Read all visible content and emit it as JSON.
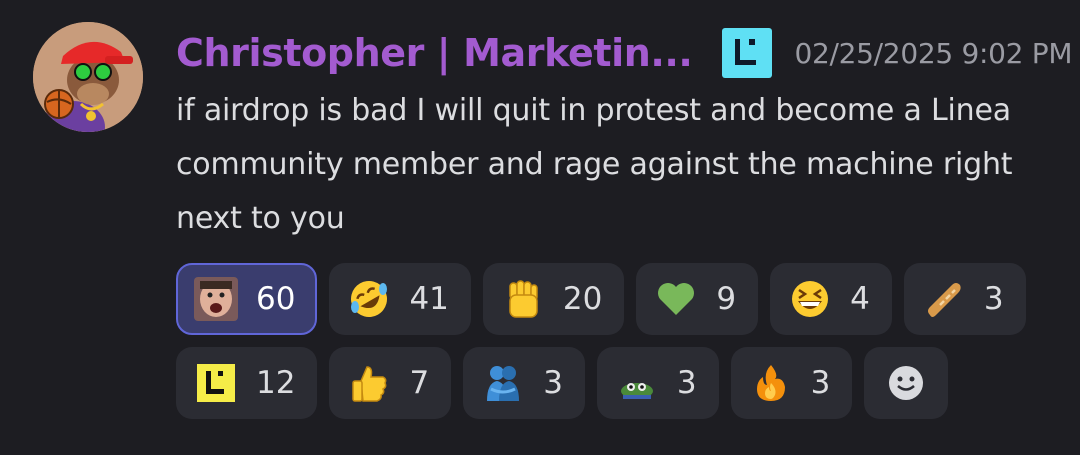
{
  "message": {
    "author": "Christopher | Marketin...",
    "role_icon": "linea-logo-icon",
    "timestamp": "02/25/2025 9:02 PM",
    "text": "if airdrop is bad I will quit in protest and become a Linea community member and rage against the machine right next to you"
  },
  "reactions": [
    {
      "emoji": "custom-face-emote",
      "count": "60",
      "active": true
    },
    {
      "emoji": "rolling-on-floor-laughing-emoji",
      "count": "41"
    },
    {
      "emoji": "raised-fist-emoji",
      "count": "20"
    },
    {
      "emoji": "green-heart-emoji",
      "count": "9"
    },
    {
      "emoji": "grinning-squinting-face-emoji",
      "count": "4"
    },
    {
      "emoji": "baguette-emoji",
      "count": "3"
    },
    {
      "emoji": "linea-logo-emote",
      "count": "12"
    },
    {
      "emoji": "thumbs-up-emoji",
      "count": "7"
    },
    {
      "emoji": "people-hugging-emoji",
      "count": "3"
    },
    {
      "emoji": "pepe-frog-emote",
      "count": "3"
    },
    {
      "emoji": "fire-emoji",
      "count": "3"
    }
  ],
  "add_reaction_icon": "add-reaction-smiley-icon",
  "colors": {
    "background": "#1d1d22",
    "username": "#a35bd0",
    "role_icon": "#5fe0f4",
    "reaction_bg": "#2b2c33",
    "reaction_active_bg": "#3a3d6e",
    "reaction_active_border": "#6066d8"
  }
}
